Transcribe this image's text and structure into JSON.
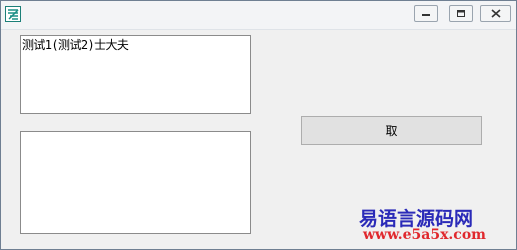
{
  "window": {
    "icon": "app-icon",
    "controls": [
      "minimize-icon",
      "maximize-icon",
      "close-icon"
    ]
  },
  "textbox1": {
    "value": "测试1(测试2)士大夫"
  },
  "textbox2": {
    "value": ""
  },
  "button": {
    "label": "取"
  },
  "watermark": {
    "line1": "易语言源码网",
    "line2": "www.e5a5x.com"
  }
}
